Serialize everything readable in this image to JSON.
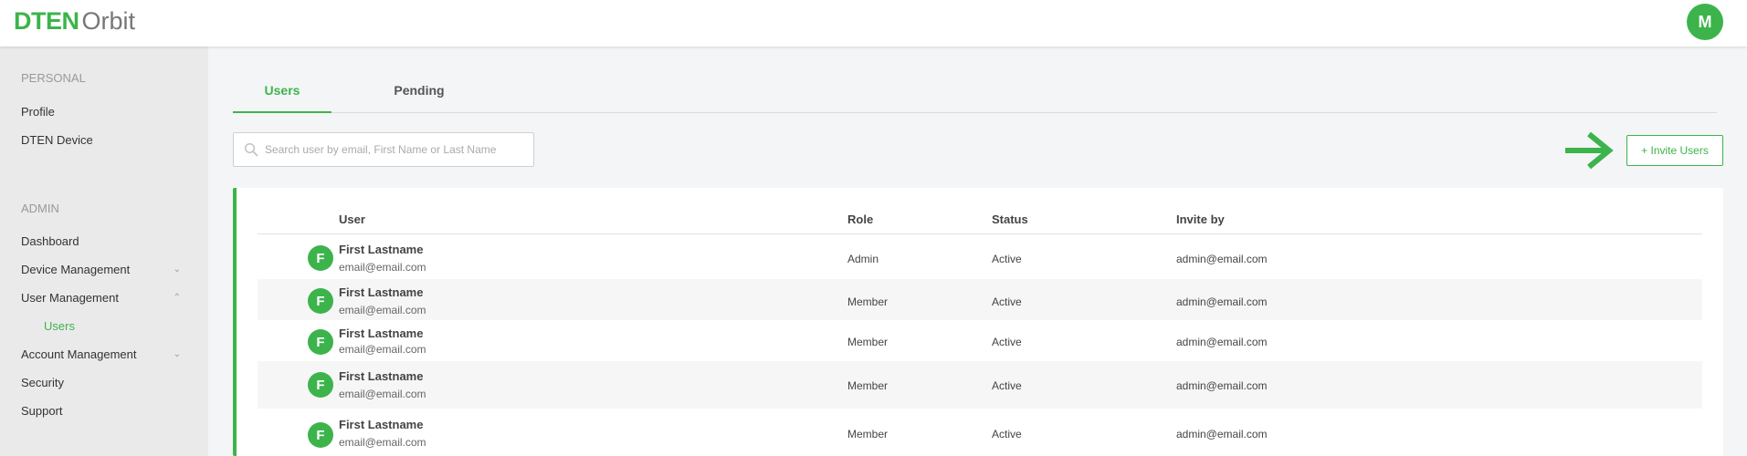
{
  "header": {
    "logo_brand": "DTEN",
    "logo_product": "Orbit",
    "avatar_initial": "M"
  },
  "sidebar": {
    "personal_heading": "PERSONAL",
    "personal_items": [
      {
        "label": "Profile"
      },
      {
        "label": "DTEN Device"
      }
    ],
    "admin_heading": "ADMIN",
    "admin_items": [
      {
        "label": "Dashboard"
      },
      {
        "label": "Device Management",
        "chevron": "chevron-down-icon"
      },
      {
        "label": "User Management",
        "chevron": "chevron-up-icon"
      },
      {
        "label": "Account Management",
        "chevron": "chevron-down-icon"
      },
      {
        "label": "Security"
      },
      {
        "label": "Support"
      }
    ],
    "user_mgmt_sub": {
      "label": "Users",
      "active": true
    }
  },
  "tabs": [
    {
      "label": "Users",
      "active": true
    },
    {
      "label": "Pending",
      "active": false
    }
  ],
  "search": {
    "placeholder": "Search user by email, First Name or Last Name",
    "value": ""
  },
  "invite_button": {
    "label": "+ Invite Users"
  },
  "table": {
    "columns": [
      "User",
      "Role",
      "Status",
      "Invite by"
    ],
    "rows": [
      {
        "initial": "F",
        "name": "First Lastname",
        "email": "email@email.com",
        "role": "Admin",
        "status": "Active",
        "invite_by": "admin@email.com"
      },
      {
        "initial": "F",
        "name": "First Lastname",
        "email": "email@email.com",
        "role": "Member",
        "status": "Active",
        "invite_by": "admin@email.com"
      },
      {
        "initial": "F",
        "name": "First Lastname",
        "email": "email@email.com",
        "role": "Member",
        "status": "Active",
        "invite_by": "admin@email.com"
      },
      {
        "initial": "F",
        "name": "First Lastname",
        "email": "email@email.com",
        "role": "Member",
        "status": "Active",
        "invite_by": "admin@email.com"
      },
      {
        "initial": "F",
        "name": "First Lastname",
        "email": "email@email.com",
        "role": "Member",
        "status": "Active",
        "invite_by": "admin@email.com"
      }
    ]
  },
  "colors": {
    "accent": "#3cb44b",
    "sidebar_bg": "#eaeaeb",
    "page_bg": "#f4f5f6"
  }
}
